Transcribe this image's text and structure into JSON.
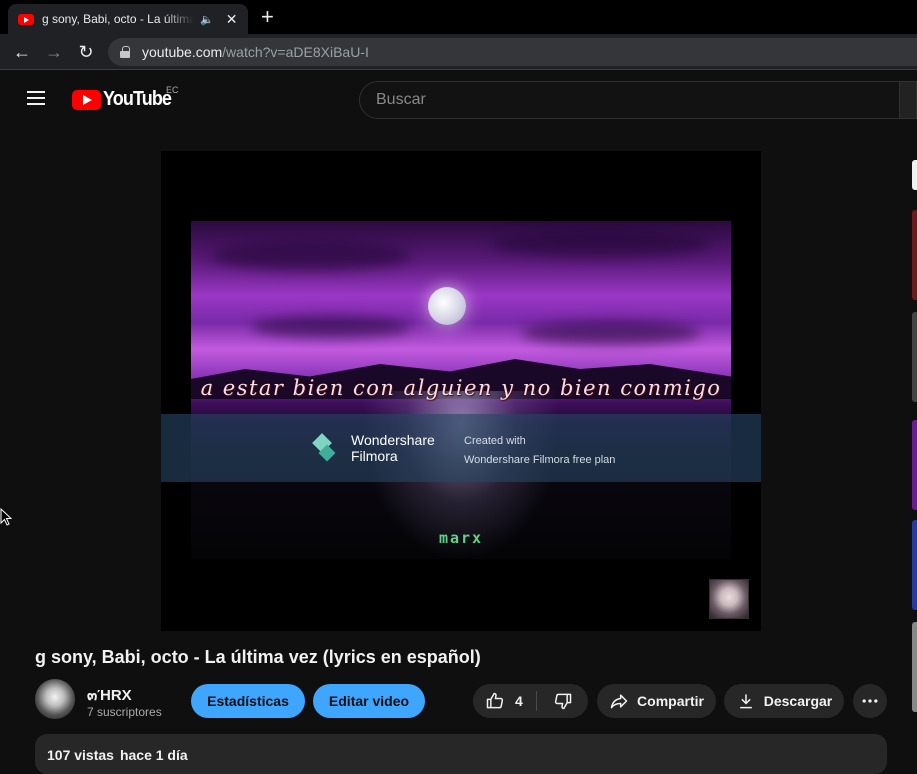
{
  "browser": {
    "tab_title": "g sony, Babi, octo - La última vez (lyrics en español)",
    "new_tab_symbol": "+",
    "url_host": "youtube.com",
    "url_path": "/watch?v=aDE8XiBaU-I"
  },
  "masthead": {
    "logo_text": "YouTube",
    "country_code": "EC",
    "search_placeholder": "Buscar"
  },
  "player": {
    "lyrics_line": "a estar bien con alguien y no bien conmigo",
    "watermark_brand_line1": "Wondershare",
    "watermark_brand_line2": "Filmora",
    "watermark_note_line1": "Created with",
    "watermark_note_line2": "Wondershare Filmora free plan",
    "channel_tag": "marx"
  },
  "video": {
    "title": "g sony, Babi, octo - La última vez (lyrics en español)",
    "channel_name": "๓ΉRX",
    "subscribers": "7 suscriptores",
    "stats_button": "Estadísticas",
    "edit_button": "Editar video",
    "like_count": "4",
    "share_button": "Compartir",
    "download_button": "Descargar",
    "views": "107 vistas",
    "posted": "hace 1 día"
  },
  "colors": {
    "youtube_red": "#ff0000",
    "accent_blue": "#3ea6ff",
    "surface": "#272727",
    "background": "#0f0f0f"
  }
}
